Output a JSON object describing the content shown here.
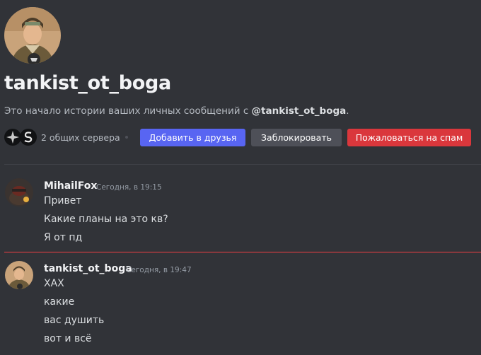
{
  "profile": {
    "username": "tankist_ot_boga",
    "intro_text": "Это начало истории ваших личных сообщений с ",
    "intro_mention": "@tankist_ot_boga",
    "intro_end": "."
  },
  "actions": {
    "mutual_servers": "2 общих сервера",
    "add_friend": "Добавить в друзья",
    "block": "Заблокировать",
    "report": "Пожаловаться на спам"
  },
  "messages": [
    {
      "author": "MihailFox",
      "timestamp": "Сегодня, в 19:15",
      "lines": [
        "Привет",
        "Какие планы на это кв?",
        "Я от пд"
      ]
    },
    {
      "author": "tankist_ot_boga",
      "timestamp": "Сегодня, в 19:47",
      "lines": [
        "ХАХ",
        "какие",
        "вас душить",
        "вот и всё"
      ]
    }
  ],
  "colors": {
    "background": "#313338",
    "primary_button": "#5865f2",
    "secondary_button": "#4e5058",
    "danger_button": "#da373c",
    "new_messages_divider": "#f23f43"
  }
}
